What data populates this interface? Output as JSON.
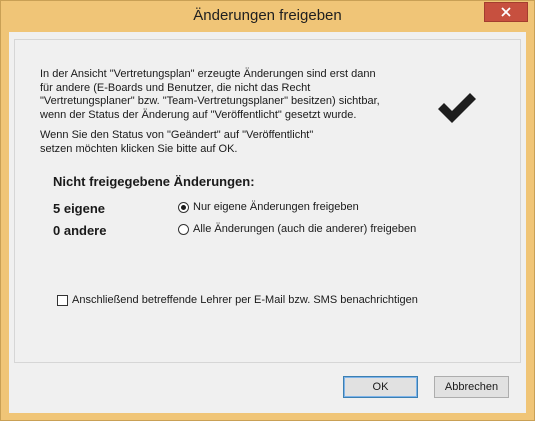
{
  "window": {
    "title": "Änderungen freigeben"
  },
  "info": {
    "paragraph1_lines": [
      "In der Ansicht \"Vertretungsplan\" erzeugte Änderungen sind erst dann",
      "für andere (E-Boards und Benutzer, die nicht das Recht",
      "\"Vertretungsplaner\" bzw. \"Team-Vertretungsplaner\" besitzen) sichtbar,",
      "wenn der Status der Änderung auf \"Veröffentlicht\" gesetzt wurde."
    ],
    "paragraph2_lines": [
      "Wenn Sie den Status von \"Geändert\" auf \"Veröffentlicht\"",
      "setzen möchten klicken Sie bitte auf OK."
    ],
    "icon": "checkmark-icon"
  },
  "section": {
    "title": "Nicht freigegebene  Änderungen:",
    "own_count": "5 eigene",
    "other_count": "0 andere"
  },
  "options": {
    "radio_own_label": "Nur eigene Änderungen freigeben",
    "radio_own_checked": true,
    "radio_all_label": "Alle Änderungen (auch die anderer) freigeben",
    "radio_all_checked": false
  },
  "notify": {
    "label": "Anschließend betreffende Lehrer per E-Mail bzw. SMS benachrichtigen",
    "checked": false
  },
  "buttons": {
    "ok": "OK",
    "cancel": "Abbrechen"
  },
  "colors": {
    "title_bar": "#f0c577",
    "close_button": "#c7503f",
    "client_bg": "#f0f0f0"
  }
}
